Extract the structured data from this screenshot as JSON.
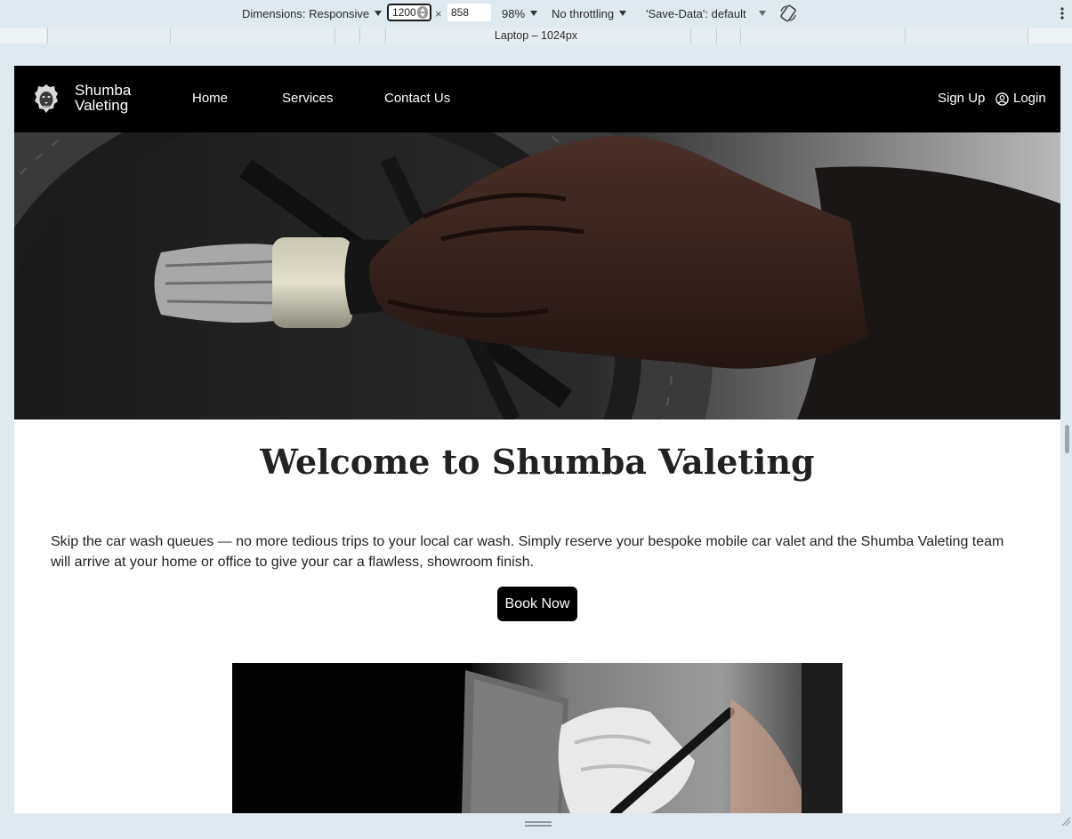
{
  "devtools": {
    "dimensions_label": "Dimensions: Responsive",
    "width_value": "1200",
    "times_sign": "×",
    "height_value": "858",
    "zoom": "98%",
    "throttling": "No throttling",
    "save_data": "'Save-Data': default",
    "device_preset": "Laptop – 1024px"
  },
  "site": {
    "brand_line1": "Shumba",
    "brand_line2": "Valeting",
    "nav": {
      "home": "Home",
      "services": "Services",
      "contact": "Contact Us",
      "signup": "Sign Up",
      "login": "Login"
    },
    "welcome_title": "Welcome to Shumba Valeting",
    "intro": "Skip the car wash queues — no more tedious trips to your local car wash. Simply reserve your bespoke mobile car valet and the Shumba Valeting team will arrive at your home or office to give your car a flawless, showroom finish.",
    "book_now": "Book Now"
  },
  "colors": {
    "navbar_bg": "#000000",
    "button_bg": "#000000",
    "devtools_bg": "#dee9f0"
  }
}
